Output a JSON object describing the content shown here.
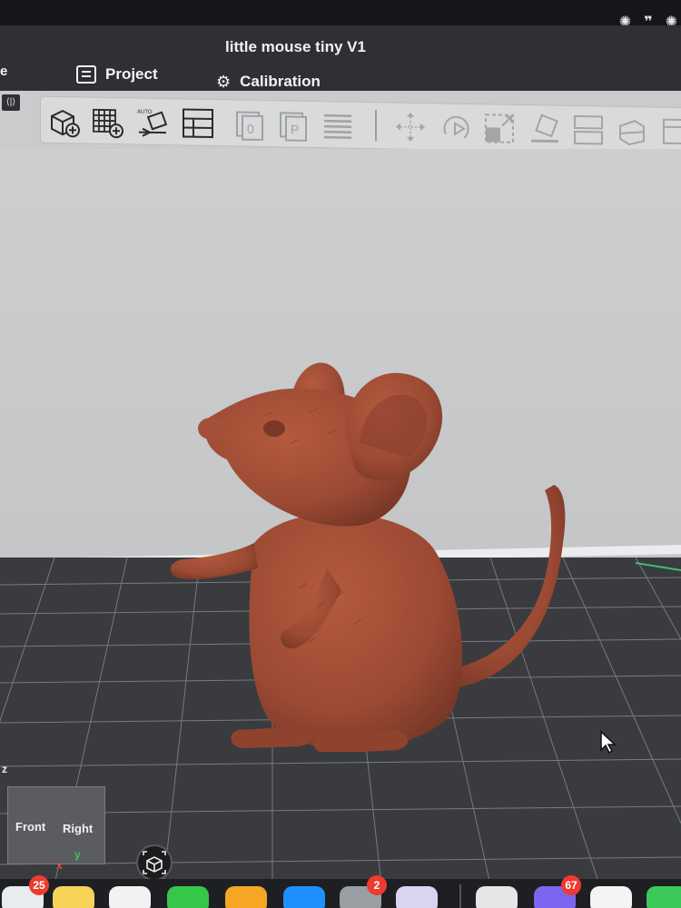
{
  "window": {
    "title": "little mouse tiny V1",
    "left_clipped_text": "e"
  },
  "tabs": [
    {
      "label": "Project",
      "icon": "list-icon"
    },
    {
      "label": "Calibration",
      "icon": "gear-icon"
    }
  ],
  "toolbar": {
    "buttons": [
      "add-object-icon",
      "add-plate-icon",
      "auto-arrange-icon",
      "layout-icon",
      "orient-0-icon",
      "orient-p-icon",
      "layers-icon",
      "move-icon",
      "rotate-icon",
      "scale-icon",
      "lay-on-face-icon",
      "split-icon",
      "cut-icon",
      "more-icon"
    ]
  },
  "viewport": {
    "model_name": "little mouse tiny V1",
    "view_cube": {
      "front": "Front",
      "right": "Right",
      "axis_x": "x",
      "axis_y": "y",
      "axis_z": "z"
    }
  },
  "status_icons": [
    "openai-icon",
    "quote-icon",
    "openai-icon"
  ],
  "dock": {
    "apps": [
      {
        "name": "mail-app",
        "badge": "25",
        "color": "#e9ecef"
      },
      {
        "name": "notes-app",
        "badge": "",
        "color": "#f7d35a"
      },
      {
        "name": "freeform-app",
        "badge": "",
        "color": "#f2f2f2"
      },
      {
        "name": "numbers-app",
        "badge": "",
        "color": "#36c74a"
      },
      {
        "name": "pages-app",
        "badge": "",
        "color": "#f5a623"
      },
      {
        "name": "appstore-app",
        "badge": "",
        "color": "#1e90ff"
      },
      {
        "name": "settings-app",
        "badge": "2",
        "color": "#9a9ea3"
      },
      {
        "name": "iphone-mirroring-app",
        "badge": "",
        "color": "#d9d4f0"
      },
      {
        "name": "chrome-app",
        "badge": "",
        "color": "#e6e6e6"
      },
      {
        "name": "discord-app",
        "badge": "67",
        "color": "#7a66f0"
      },
      {
        "name": "chatgpt-app",
        "badge": "",
        "color": "#f4f4f4"
      },
      {
        "name": "numbers-app-2",
        "badge": "",
        "color": "#3cc95a"
      }
    ]
  },
  "colors": {
    "model": "#9c4a33",
    "plate": "#393b3f",
    "background": "#c9cbcd",
    "titlebar": "#2f3033"
  }
}
